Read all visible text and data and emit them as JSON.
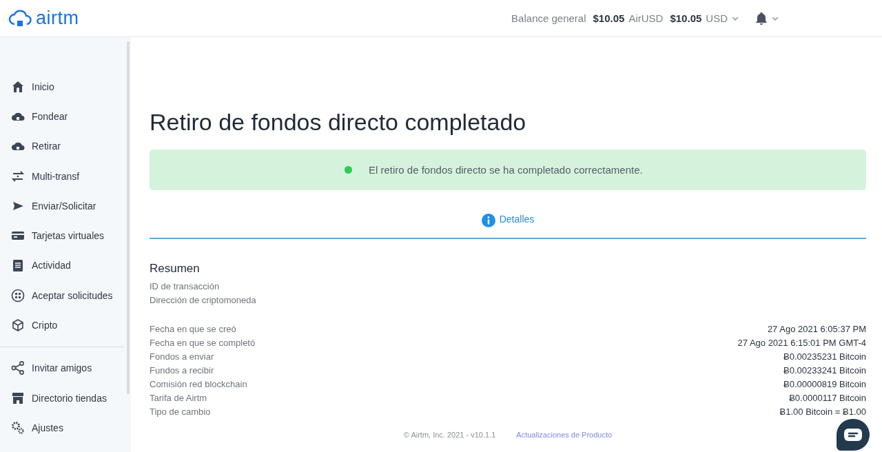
{
  "header": {
    "logo": "airtm",
    "balance_label": "Balance general",
    "balances": [
      {
        "amount": "$10.05",
        "currency": "AirUSD"
      },
      {
        "amount": "$10.05",
        "currency": "USD"
      }
    ]
  },
  "sidebar": {
    "items": [
      {
        "label": "Inicio"
      },
      {
        "label": "Fondear"
      },
      {
        "label": "Retirar"
      },
      {
        "label": "Multi-transf"
      },
      {
        "label": "Enviar/Solicitar"
      },
      {
        "label": "Tarjetas virtuales"
      },
      {
        "label": "Actividad"
      },
      {
        "label": "Aceptar solicitudes"
      },
      {
        "label": "Cripto"
      }
    ],
    "bottom_items": [
      {
        "label": "Invitar amigos"
      },
      {
        "label": "Directorio tiendas"
      },
      {
        "label": "Ajustes"
      }
    ]
  },
  "page": {
    "title": "Retiro de fondos directo completado",
    "alert": {
      "message": "El retiro de fondos directo se ha completado correctamente.",
      "color": "#2ecc52"
    },
    "tabs": [
      {
        "label": "Detalles",
        "selected": true
      }
    ]
  },
  "summary": {
    "title": "Resumen",
    "fields": [
      "ID de transacción",
      "Dirección de criptomoneda"
    ],
    "rows": [
      {
        "label": "Fecha en que se creó",
        "value": "27 Ago 2021 6:05:37 PM"
      },
      {
        "label": "Fecha en que se completó",
        "value": "27 Ago 2021 6:15:01 PM GMT-4"
      },
      {
        "label": "Fondos a enviar",
        "value": "Ƀ0.00235231 Bitcoin"
      },
      {
        "label": "Fundos a recibir",
        "value": "Ƀ0.00233241 Bitcoin"
      },
      {
        "label": "Comisión red blockchain",
        "value": "Ƀ0.00000819 Bitcoin"
      },
      {
        "label": "Tarifa de Airtm",
        "value": "Ƀ0.0000117 Bitcoin"
      },
      {
        "label": "Tipo de cambio",
        "value": "Ƀ1.00 Bitcoin = Ƀ1.00"
      }
    ]
  },
  "footer": {
    "copyright": "© Airtm, Inc. 2021 - v10.1.1",
    "link": "Actualizaciones de Producto"
  }
}
